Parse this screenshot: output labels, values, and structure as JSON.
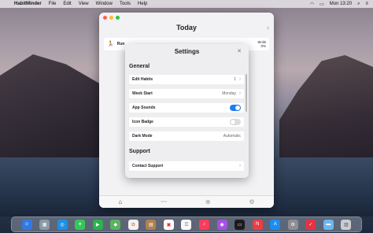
{
  "menubar": {
    "apple_icon": "apple-icon",
    "app_name": "HabitMinder",
    "items": [
      "File",
      "Edit",
      "View",
      "Window",
      "Tools",
      "Help"
    ],
    "clock": "Mon 13:20"
  },
  "window": {
    "title": "Today",
    "habit": {
      "name": "Run",
      "goal": "8mils",
      "progress": "0%"
    },
    "tabs": [
      "home-icon",
      "stats-icon",
      "add-icon",
      "settings-icon"
    ]
  },
  "settings": {
    "title": "Settings",
    "sections": {
      "general": "General",
      "support": "Support"
    },
    "rows": {
      "edit_habits": {
        "label": "Edit Habits",
        "value": "1"
      },
      "week_start": {
        "label": "Week Start",
        "value": "Monday"
      },
      "app_sounds": {
        "label": "App Sounds",
        "on": true
      },
      "icon_badge": {
        "label": "Icon Badge",
        "on": false
      },
      "dark_mode": {
        "label": "Dark Mode",
        "value": "Automatic"
      },
      "contact_support": {
        "label": "Contact Support"
      }
    }
  },
  "colors": {
    "accent": "#1f7cf2",
    "habit_icon": "#e0245e"
  },
  "dock": [
    "finder-icon",
    "launchpad-icon",
    "safari-icon",
    "messages-icon",
    "facetime-icon",
    "maps-icon",
    "photos-icon",
    "notes-icon",
    "calendar-icon",
    "reminders-icon",
    "music-icon",
    "podcasts-icon",
    "tv-icon",
    "news-icon",
    "appstore-icon",
    "system-preferences-icon",
    "habitminder-icon",
    "folder-icon",
    "trash-icon"
  ]
}
